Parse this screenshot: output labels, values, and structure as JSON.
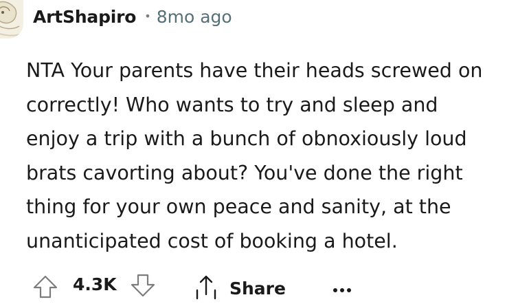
{
  "comment": {
    "username": "ArtShapiro",
    "separator": "•",
    "time_ago": "8mo ago",
    "text": "NTA Your parents have their heads screwed on\ncorrectly! Who wants to try and sleep and\nenjoy a trip with a bunch of obnoxiously loud\nbrats cavorting about? You've done the right\nthing for your own peace and sanity, at the\nunanticipated cost of booking a hotel."
  },
  "actions": {
    "score": "4.3K",
    "share_label": "Share",
    "upvote_icon": "upvote-arrow-icon",
    "downvote_icon": "downvote-arrow-icon",
    "share_icon": "share-icon",
    "more_icon": "ellipsis-icon"
  },
  "colors": {
    "text": "#1a1a1b",
    "meta": "#576f76",
    "icon": "#7c7c7c"
  }
}
